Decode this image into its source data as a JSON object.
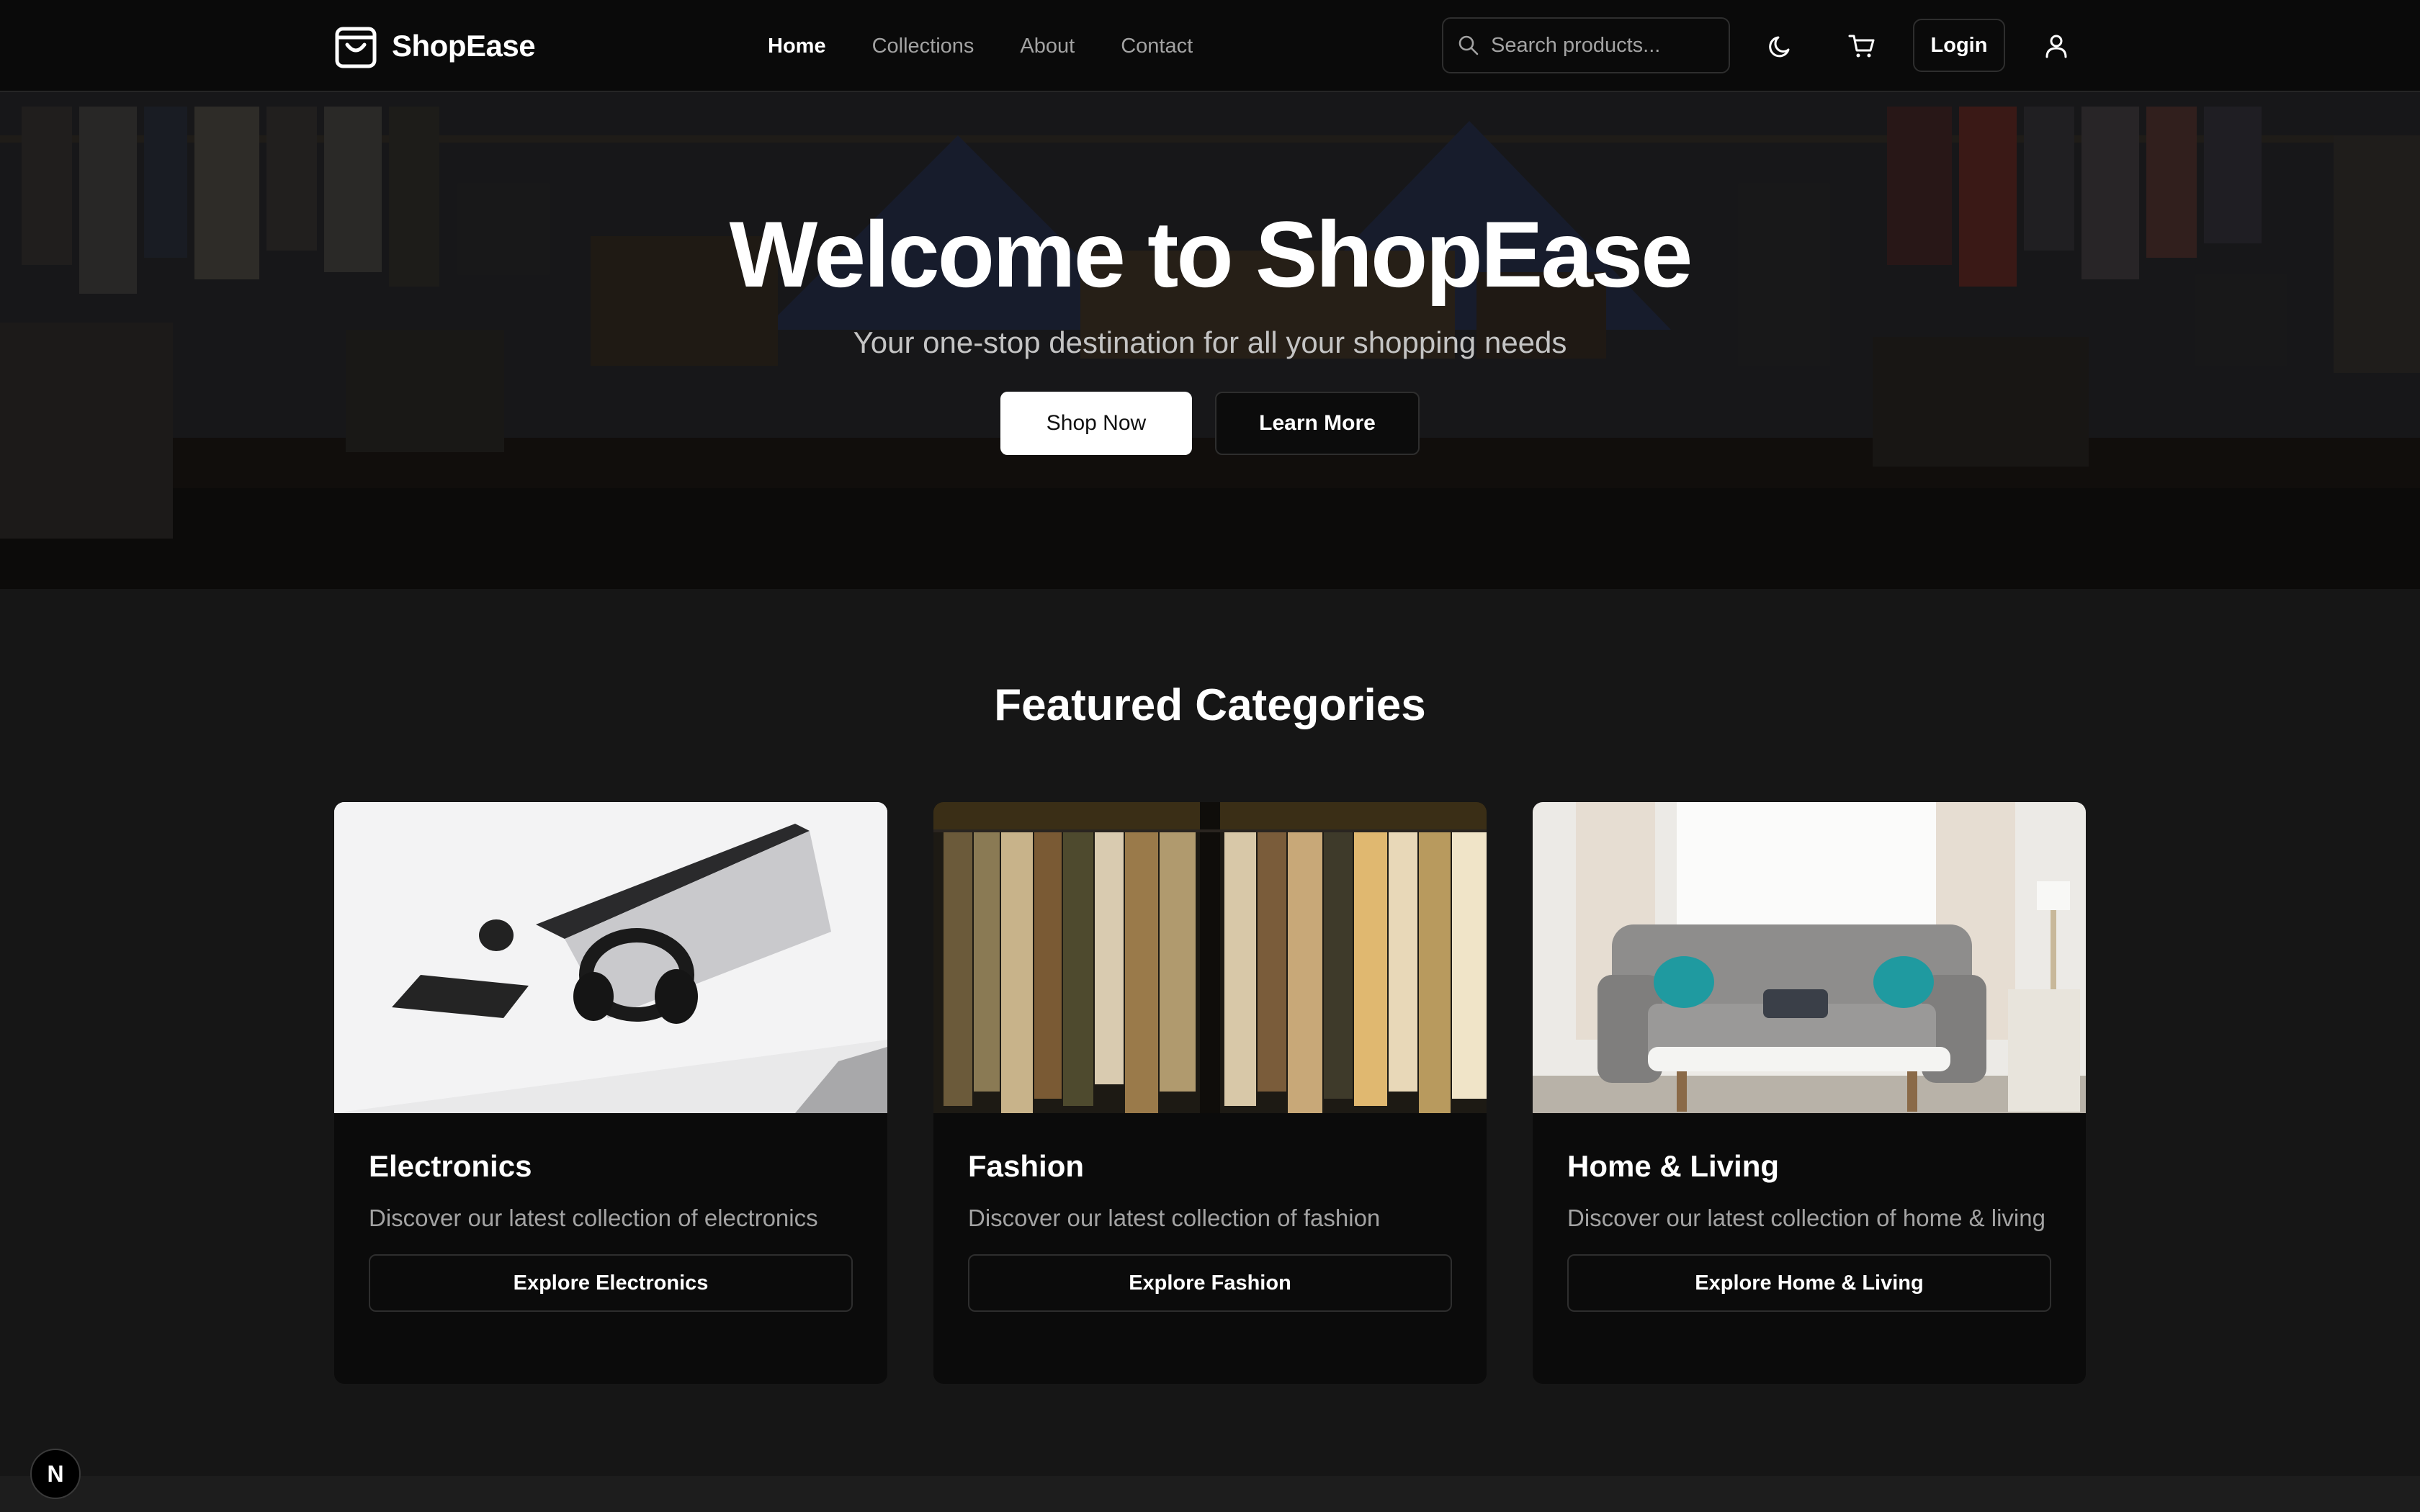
{
  "brand": {
    "name": "ShopEase",
    "icon": "shopping-bag-icon"
  },
  "nav": {
    "links": [
      {
        "label": "Home",
        "active": true
      },
      {
        "label": "Collections",
        "active": false
      },
      {
        "label": "About",
        "active": false
      },
      {
        "label": "Contact",
        "active": false
      }
    ]
  },
  "search": {
    "placeholder": "Search products...",
    "value": "",
    "icon": "search-icon"
  },
  "actions": {
    "theme_icon": "moon-icon",
    "cart_icon": "cart-icon",
    "login_label": "Login",
    "user_icon": "user-icon"
  },
  "hero": {
    "title": "Welcome to ShopEase",
    "subtitle": "Your one-stop destination for all your shopping needs",
    "primary_label": "Shop Now",
    "secondary_label": "Learn More"
  },
  "featured": {
    "title": "Featured Categories",
    "cards": [
      {
        "title": "Electronics",
        "description": "Discover our latest collection of electronics",
        "button": "Explore Electronics"
      },
      {
        "title": "Fashion",
        "description": "Discover our latest collection of fashion",
        "button": "Explore Fashion"
      },
      {
        "title": "Home & Living",
        "description": "Discover our latest collection of home & living",
        "button": "Explore Home & Living"
      }
    ]
  },
  "dev_badge": {
    "label": "N"
  },
  "colors": {
    "background": "#161616",
    "navbar": "#0a0a0a",
    "card": "#0b0b0b",
    "border": "#2e2e2e",
    "muted_text": "#a3a3a3",
    "primary_button": "#ffffff"
  }
}
